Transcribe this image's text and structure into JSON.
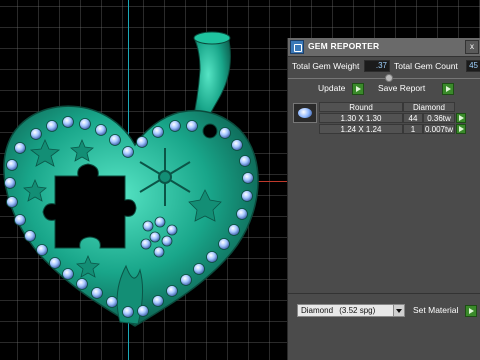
{
  "window": {
    "title": "GEM REPORTER",
    "close_glyph": "x"
  },
  "totals": {
    "weight_label": "Total Gem Weight",
    "weight_value": ".37",
    "count_label": "Total Gem Count",
    "count_value": "45"
  },
  "actions": {
    "update_label": "Update",
    "save_report_label": "Save Report"
  },
  "table": {
    "columns": [
      "Round",
      "Diamond"
    ],
    "rows": [
      {
        "size": "1.30 X 1.30",
        "count": "44",
        "weight": "0.36tw"
      },
      {
        "size": "1.24 X 1.24",
        "count": "1",
        "weight": "0.007tw"
      }
    ]
  },
  "material": {
    "selected": "Diamond",
    "selected_detail": "(3.52 spg)",
    "set_label": "Set Material"
  },
  "colors": {
    "pendant": "#19a68a",
    "gem": "#a6c8ff",
    "accent_green": "#3a8a2a",
    "panel_bg": "#4b4b4b"
  },
  "icons": {
    "title": "gem-reporter-icon",
    "gem_thumb": "round-diamond-thumbnail"
  }
}
